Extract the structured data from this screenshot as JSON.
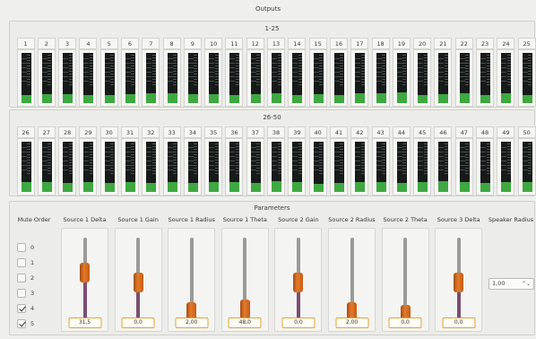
{
  "outputs": {
    "title": "Outputs",
    "group1": {
      "title": "1-25",
      "channels": [
        {
          "label": "1",
          "level": 0.16
        },
        {
          "label": "2",
          "level": 0.18
        },
        {
          "label": "3",
          "level": 0.18
        },
        {
          "label": "4",
          "level": 0.16
        },
        {
          "label": "5",
          "level": 0.16
        },
        {
          "label": "6",
          "level": 0.18
        },
        {
          "label": "7",
          "level": 0.2
        },
        {
          "label": "8",
          "level": 0.2
        },
        {
          "label": "9",
          "level": 0.18
        },
        {
          "label": "10",
          "level": 0.18
        },
        {
          "label": "11",
          "level": 0.16
        },
        {
          "label": "12",
          "level": 0.18
        },
        {
          "label": "13",
          "level": 0.2
        },
        {
          "label": "14",
          "level": 0.16
        },
        {
          "label": "15",
          "level": 0.18
        },
        {
          "label": "16",
          "level": 0.16
        },
        {
          "label": "17",
          "level": 0.2
        },
        {
          "label": "18",
          "level": 0.2
        },
        {
          "label": "19",
          "level": 0.22
        },
        {
          "label": "20",
          "level": 0.16
        },
        {
          "label": "21",
          "level": 0.18
        },
        {
          "label": "22",
          "level": 0.2
        },
        {
          "label": "23",
          "level": 0.16
        },
        {
          "label": "24",
          "level": 0.2
        },
        {
          "label": "25",
          "level": 0.16
        }
      ]
    },
    "group2": {
      "title": "26-50",
      "channels": [
        {
          "label": "26",
          "level": 0.2
        },
        {
          "label": "27",
          "level": 0.2
        },
        {
          "label": "28",
          "level": 0.18
        },
        {
          "label": "29",
          "level": 0.2
        },
        {
          "label": "30",
          "level": 0.18
        },
        {
          "label": "31",
          "level": 0.2
        },
        {
          "label": "32",
          "level": 0.18
        },
        {
          "label": "33",
          "level": 0.2
        },
        {
          "label": "34",
          "level": 0.18
        },
        {
          "label": "35",
          "level": 0.2
        },
        {
          "label": "36",
          "level": 0.2
        },
        {
          "label": "37",
          "level": 0.18
        },
        {
          "label": "38",
          "level": 0.22
        },
        {
          "label": "39",
          "level": 0.2
        },
        {
          "label": "40",
          "level": 0.16
        },
        {
          "label": "41",
          "level": 0.18
        },
        {
          "label": "42",
          "level": 0.2
        },
        {
          "label": "43",
          "level": 0.2
        },
        {
          "label": "44",
          "level": 0.18
        },
        {
          "label": "45",
          "level": 0.2
        },
        {
          "label": "46",
          "level": 0.22
        },
        {
          "label": "47",
          "level": 0.2
        },
        {
          "label": "48",
          "level": 0.18
        },
        {
          "label": "49",
          "level": 0.2
        },
        {
          "label": "50",
          "level": 0.2
        }
      ]
    }
  },
  "parameters": {
    "title": "Parameters",
    "mute_order": {
      "label": "Mute Order",
      "items": [
        {
          "label": "0",
          "checked": false
        },
        {
          "label": "1",
          "checked": false
        },
        {
          "label": "2",
          "checked": false
        },
        {
          "label": "3",
          "checked": false
        },
        {
          "label": "4",
          "checked": true
        },
        {
          "label": "5",
          "checked": true
        }
      ]
    },
    "sliders": [
      {
        "label": "Source 1 Delta",
        "value": "31,5",
        "position": 0.58
      },
      {
        "label": "Source 1 Gain",
        "value": "0,0",
        "position": 0.46
      },
      {
        "label": "Source 1 Radius",
        "value": "2,00",
        "position": 0.1
      },
      {
        "label": "Source 1 Theta",
        "value": "48,0",
        "position": 0.13
      },
      {
        "label": "Source 2 Gain",
        "value": "0,0",
        "position": 0.46
      },
      {
        "label": "Source 2 Radius",
        "value": "2,00",
        "position": 0.1
      },
      {
        "label": "Source 2 Theta",
        "value": "0,0",
        "position": 0.07
      },
      {
        "label": "Source 3 Delta",
        "value": "0,0",
        "position": 0.46
      }
    ],
    "speaker_radius": {
      "label": "Speaker Radius",
      "value": "1,00",
      "arrows": "⌃⌄"
    }
  },
  "colors": {
    "meter_fill": "#3ea841",
    "slider_handle": "#e47a2a",
    "slider_fill": "#7b4d72",
    "value_border": "#e0a436"
  }
}
